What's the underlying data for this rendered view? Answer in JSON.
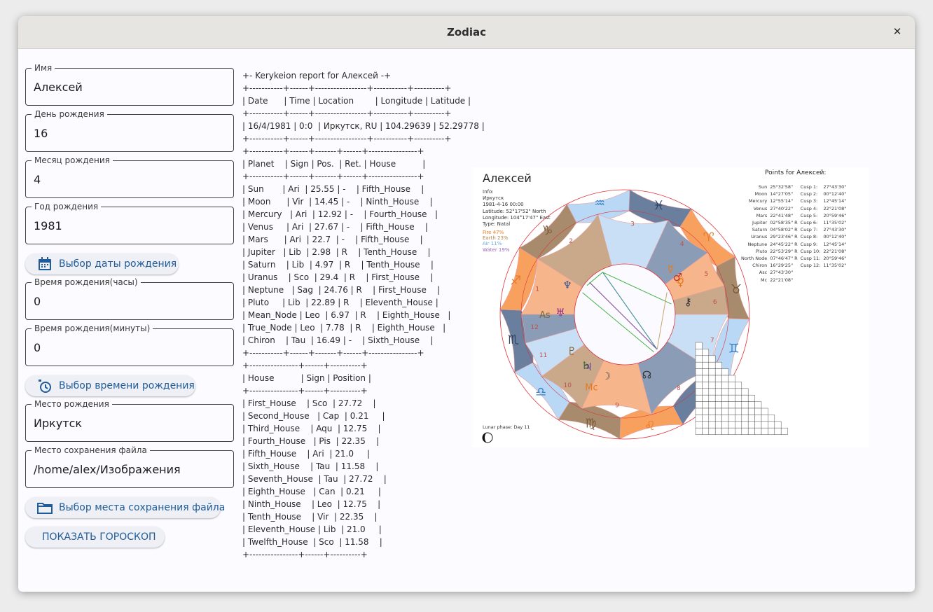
{
  "window": {
    "title": "Zodiac"
  },
  "form": {
    "name": {
      "label": "Имя",
      "value": "Алексей"
    },
    "day": {
      "label": "День рождения",
      "value": "16"
    },
    "month": {
      "label": "Месяц рождения",
      "value": "4"
    },
    "year": {
      "label": "Год рождения",
      "value": "1981"
    },
    "date_button": "Выбор даты рождения",
    "hours": {
      "label": "Время рождения(часы)",
      "value": "0"
    },
    "minutes": {
      "label": "Время рождения(минуты)",
      "value": "0"
    },
    "time_button": "Выбор времени рождения",
    "place": {
      "label": "Место рождения",
      "value": "Иркутск"
    },
    "save_path": {
      "label": "Место сохранения файла",
      "value": "/home/alex/Изображения"
    },
    "save_button": "Выбор места сохранения файла",
    "show_button": "ПОКАЗАТЬ ГОРОСКОП"
  },
  "report_lines": [
    "+- Kerykeion report for Алексей -+",
    "+-----------+------+-----------------+-----------+----------+",
    "| Date      | Time | Location        | Longitude | Latitude |",
    "+-----------+------+-----------------+-----------+----------+",
    "| 16/4/1981 | 0:0  | Иркутск, RU | 104.29639 | 52.29778 |",
    "+-----------+------+-----------------+-----------+----------+",
    "+-----------+------+-------+------+----------------+",
    "| Planet    | Sign | Pos.  | Ret. | House          |",
    "+-----------+------+-------+------+----------------+",
    "| Sun       | Ari  | 25.55 | -    | Fifth_House    |",
    "| Moon      | Vir  | 14.45 | -    | Ninth_House    |",
    "| Mercury   | Ari  | 12.92 | -    | Fourth_House   |",
    "| Venus     | Ari  | 27.67 | -    | Fifth_House    |",
    "| Mars      | Ari  | 22.7  | -    | Fifth_House    |",
    "| Jupiter   | Lib  | 2.98  | R    | Tenth_House    |",
    "| Saturn    | Lib  | 4.97  | R    | Tenth_House    |",
    "| Uranus    | Sco  | 29.4  | R    | First_House    |",
    "| Neptune   | Sag  | 24.76 | R    | First_House    |",
    "| Pluto     | Lib  | 22.89 | R    | Eleventh_House |",
    "| Mean_Node | Leo  | 6.97  | R    | Eighth_House   |",
    "| True_Node | Leo  | 7.78  | R    | Eighth_House   |",
    "| Chiron    | Tau  | 16.49 | -    | Sixth_House    |",
    "+-----------+------+-------+------+----------------+",
    "+----------------+------+----------+",
    "| House          | Sign | Position |",
    "+----------------+------+----------+",
    "| First_House    | Sco  | 27.72    |",
    "| Second_House   | Cap  | 0.21     |",
    "| Third_House    | Aqu  | 12.75    |",
    "| Fourth_House   | Pis  | 22.35    |",
    "| Fifth_House    | Ari  | 21.0     |",
    "| Sixth_House    | Tau  | 11.58    |",
    "| Seventh_House  | Tau  | 27.72    |",
    "| Eighth_House   | Can  | 0.21     |",
    "| Ninth_House    | Leo  | 12.75    |",
    "| Tenth_House    | Vir  | 22.35    |",
    "| Eleventh_House | Lib  | 21.0     |",
    "| Twelfth_House  | Sco  | 11.58    |",
    "+----------------+------+----------+"
  ],
  "chart": {
    "name": "Алексей",
    "info_lines": [
      "Info:",
      "Иркутск",
      "1981-4-16 00:00",
      "Latitude: 52°17'52\" North",
      "Longitude: 104°17'47\" East",
      "Type: Natal"
    ],
    "elements": [
      {
        "text": "Fire 47%",
        "color": "#f07c1c"
      },
      {
        "text": "Earth 23%",
        "color": "#b4864a"
      },
      {
        "text": "Air 11%",
        "color": "#6ba8e2"
      },
      {
        "text": "Water 19%",
        "color": "#9b67c4"
      }
    ],
    "lunar_phase": "Lunar phase: Day 11",
    "points_title": "Points for Алексей:",
    "points": [
      {
        "name": "Sun",
        "pos": "25°32'58\"",
        "cusp": "Cusp 1:",
        "cusp_pos": "27°43'30\""
      },
      {
        "name": "Moon",
        "pos": "14°27'05\"",
        "cusp": "Cusp 2:",
        "cusp_pos": "00°12'40\""
      },
      {
        "name": "Mercury",
        "pos": "12°55'14\"",
        "cusp": "Cusp 3:",
        "cusp_pos": "12°45'14\""
      },
      {
        "name": "Venus",
        "pos": "27°40'22\"",
        "cusp": "Cusp 4:",
        "cusp_pos": "22°21'08\""
      },
      {
        "name": "Mars",
        "pos": "22°41'48\"",
        "cusp": "Cusp 5:",
        "cusp_pos": "20°59'46\""
      },
      {
        "name": "Jupiter",
        "pos": "02°58'35\" R",
        "cusp": "Cusp 6:",
        "cusp_pos": "11°35'02\""
      },
      {
        "name": "Saturn",
        "pos": "04°58'02\" R",
        "cusp": "Cusp 7:",
        "cusp_pos": "27°43'30\""
      },
      {
        "name": "Uranus",
        "pos": "29°23'46\" R",
        "cusp": "Cusp 8:",
        "cusp_pos": "00°12'40\""
      },
      {
        "name": "Neptune",
        "pos": "24°45'22\" R",
        "cusp": "Cusp 9:",
        "cusp_pos": "12°45'14\""
      },
      {
        "name": "Pluto",
        "pos": "22°53'29\" R",
        "cusp": "Cusp 10:",
        "cusp_pos": "22°21'08\""
      },
      {
        "name": "North Node",
        "pos": "07°46'47\" R",
        "cusp": "Cusp 11:",
        "cusp_pos": "20°59'46\""
      },
      {
        "name": "Chiron",
        "pos": "16°29'25\"",
        "cusp": "Cusp 12:",
        "cusp_pos": "11°35'02\""
      },
      {
        "name": "Asc",
        "pos": "27°43'30\"",
        "cusp": "",
        "cusp_pos": ""
      },
      {
        "name": "Mc",
        "pos": "22°21'08\"",
        "cusp": "",
        "cusp_pos": ""
      }
    ],
    "sign_glyphs": [
      "♈",
      "♉",
      "♊",
      "♋",
      "♌",
      "♍",
      "♎",
      "♏",
      "♐",
      "♑",
      "♒",
      "♓"
    ],
    "house_numbers": [
      "1",
      "2",
      "3",
      "4",
      "5",
      "6",
      "7",
      "8",
      "9",
      "10",
      "11",
      "12"
    ],
    "angle_labels": {
      "asc": "As",
      "mc": "Mc"
    },
    "planet_glyphs": {
      "sun": "☉",
      "moon": "☽",
      "mercury": "☿",
      "venus": "♀",
      "mars": "♂",
      "jupiter": "♃",
      "saturn": "♄",
      "uranus": "♅",
      "neptune": "♆",
      "pluto": "♇",
      "node": "☊",
      "chiron": "⚷"
    },
    "colors": {
      "fire": "#f8a15e",
      "earth": "#a88b6c",
      "air": "#8fc2f0",
      "water": "#5d7394",
      "accent": "#e0303a"
    }
  }
}
